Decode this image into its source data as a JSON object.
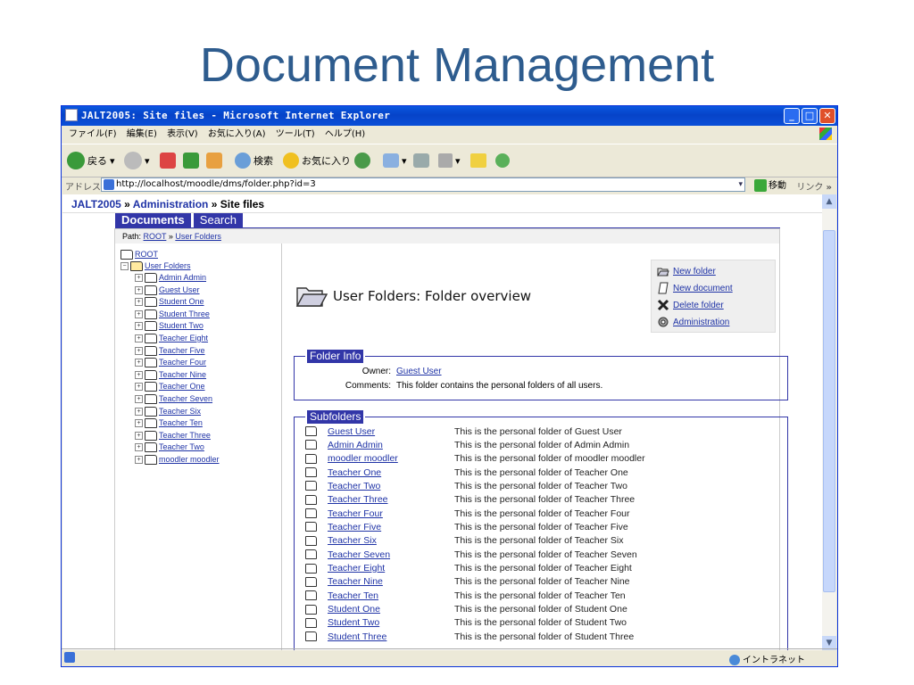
{
  "slide": {
    "title": "Document Management"
  },
  "window": {
    "title": "JALT2005: Site files - Microsoft Internet Explorer",
    "buttons": {
      "minimize": "_",
      "maximize": "□",
      "close": "✕"
    }
  },
  "menu": [
    "ファイル(F)",
    "編集(E)",
    "表示(V)",
    "お気に入り(A)",
    "ツール(T)",
    "ヘルプ(H)"
  ],
  "toolbar": {
    "back": "戻る",
    "search": "検索",
    "favorites": "お気に入り"
  },
  "address": {
    "label": "アドレス(D)",
    "url": "http://localhost/moodle/dms/folder.php?id=3",
    "go": "移動",
    "links": "リンク",
    "more": "»"
  },
  "breadcrumb": {
    "site": "JALT2005",
    "sep": " » ",
    "admin": "Administration",
    "current": "Site files"
  },
  "tabs": [
    {
      "label": "Documents"
    },
    {
      "label": "Search"
    }
  ],
  "path": {
    "prefix": "Path: ",
    "root": "ROOT",
    "sep": " » ",
    "current": "User Folders"
  },
  "tree": {
    "root": "ROOT",
    "expanded": "User Folders",
    "children": [
      "Admin Admin",
      "Guest User",
      "Student One",
      "Student Three",
      "Student Two",
      "Teacher Eight",
      "Teacher Five",
      "Teacher Four",
      "Teacher Nine",
      "Teacher One",
      "Teacher Seven",
      "Teacher Six",
      "Teacher Ten",
      "Teacher Three",
      "Teacher Two",
      "moodler moodler"
    ]
  },
  "overview": {
    "heading": "User Folders: Folder overview"
  },
  "actions": [
    "New folder",
    "New document",
    "Delete folder",
    "Administration"
  ],
  "folder_info": {
    "legend": "Folder Info",
    "owner_label": "Owner:",
    "owner": "Guest User",
    "comments_label": "Comments:",
    "comments": "This folder contains the personal folders of all users."
  },
  "subfolders": {
    "legend": "Subfolders",
    "rows": [
      {
        "name": "Guest User",
        "desc": "This is the personal folder of Guest User"
      },
      {
        "name": "Admin Admin",
        "desc": "This is the personal folder of Admin Admin"
      },
      {
        "name": "moodler moodler",
        "desc": "This is the personal folder of moodler moodler"
      },
      {
        "name": "Teacher One",
        "desc": "This is the personal folder of Teacher One"
      },
      {
        "name": "Teacher Two",
        "desc": "This is the personal folder of Teacher Two"
      },
      {
        "name": "Teacher Three",
        "desc": "This is the personal folder of Teacher Three"
      },
      {
        "name": "Teacher Four",
        "desc": "This is the personal folder of Teacher Four"
      },
      {
        "name": "Teacher Five",
        "desc": "This is the personal folder of Teacher Five"
      },
      {
        "name": "Teacher Six",
        "desc": "This is the personal folder of Teacher Six"
      },
      {
        "name": "Teacher Seven",
        "desc": "This is the personal folder of Teacher Seven"
      },
      {
        "name": "Teacher Eight",
        "desc": "This is the personal folder of Teacher Eight"
      },
      {
        "name": "Teacher Nine",
        "desc": "This is the personal folder of Teacher Nine"
      },
      {
        "name": "Teacher Ten",
        "desc": "This is the personal folder of Teacher Ten"
      },
      {
        "name": "Student One",
        "desc": "This is the personal folder of Student One"
      },
      {
        "name": "Student Two",
        "desc": "This is the personal folder of Student Two"
      },
      {
        "name": "Student Three",
        "desc": "This is the personal folder of Student Three"
      }
    ]
  },
  "status": {
    "zone": "イントラネット"
  }
}
